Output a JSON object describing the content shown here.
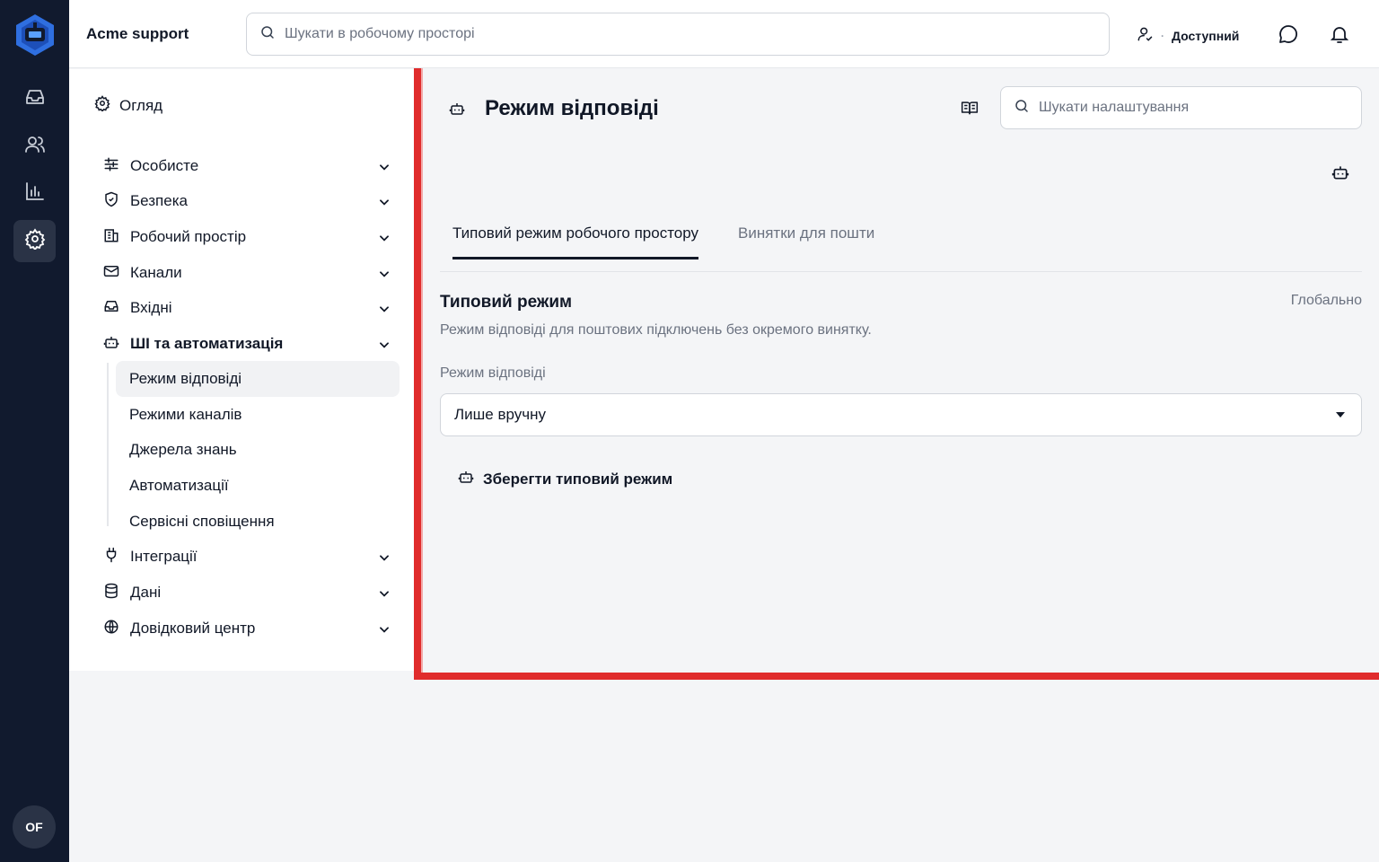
{
  "app": {
    "workspace_name": "Acme support",
    "search_placeholder": "Шукати в робочому просторі",
    "status": "Доступний",
    "user_initials": "OF"
  },
  "rail": {
    "items": [
      {
        "icon": "inbox-icon"
      },
      {
        "icon": "users-icon"
      },
      {
        "icon": "bar-chart-icon"
      },
      {
        "icon": "gear-icon",
        "active": true
      }
    ]
  },
  "nav": {
    "overview": "Огляд",
    "sections": [
      {
        "label": "Особисте",
        "icon": "sliders-icon"
      },
      {
        "label": "Безпека",
        "icon": "shield-icon"
      },
      {
        "label": "Робочий простір",
        "icon": "building-icon"
      },
      {
        "label": "Канали",
        "icon": "mail-icon"
      },
      {
        "label": "Вхідні",
        "icon": "inbox-icon"
      },
      {
        "label": "ШІ та автоматизація",
        "icon": "bot-icon",
        "expanded": true
      },
      {
        "label": "Інтеграції",
        "icon": "plug-icon"
      },
      {
        "label": "Дані",
        "icon": "database-icon"
      },
      {
        "label": "Довідковий центр",
        "icon": "globe-icon"
      }
    ],
    "subitems": [
      {
        "label": "Режим відповіді",
        "active": true
      },
      {
        "label": "Режими каналів"
      },
      {
        "label": "Джерела знань"
      },
      {
        "label": "Автоматизації"
      },
      {
        "label": "Сервісні сповіщення"
      }
    ]
  },
  "main": {
    "title": "Режим відповіді",
    "search_placeholder": "Шукати налаштування",
    "tabs": [
      {
        "label": "Типовий режим робочого простору",
        "active": true
      },
      {
        "label": "Винятки для пошти"
      }
    ],
    "section": {
      "title": "Типовий режим",
      "scope": "Глобально",
      "description": "Режим відповіді для поштових підключень без окремого винятку.",
      "field_label": "Режим відповіді",
      "field_value": "Лише вручну",
      "save_label": "Зберегти типовий режим"
    }
  },
  "colors": {
    "rail_bg": "#111a2e",
    "brand_blue": "#2f6fe0",
    "highlight_red": "#e02c2c"
  }
}
